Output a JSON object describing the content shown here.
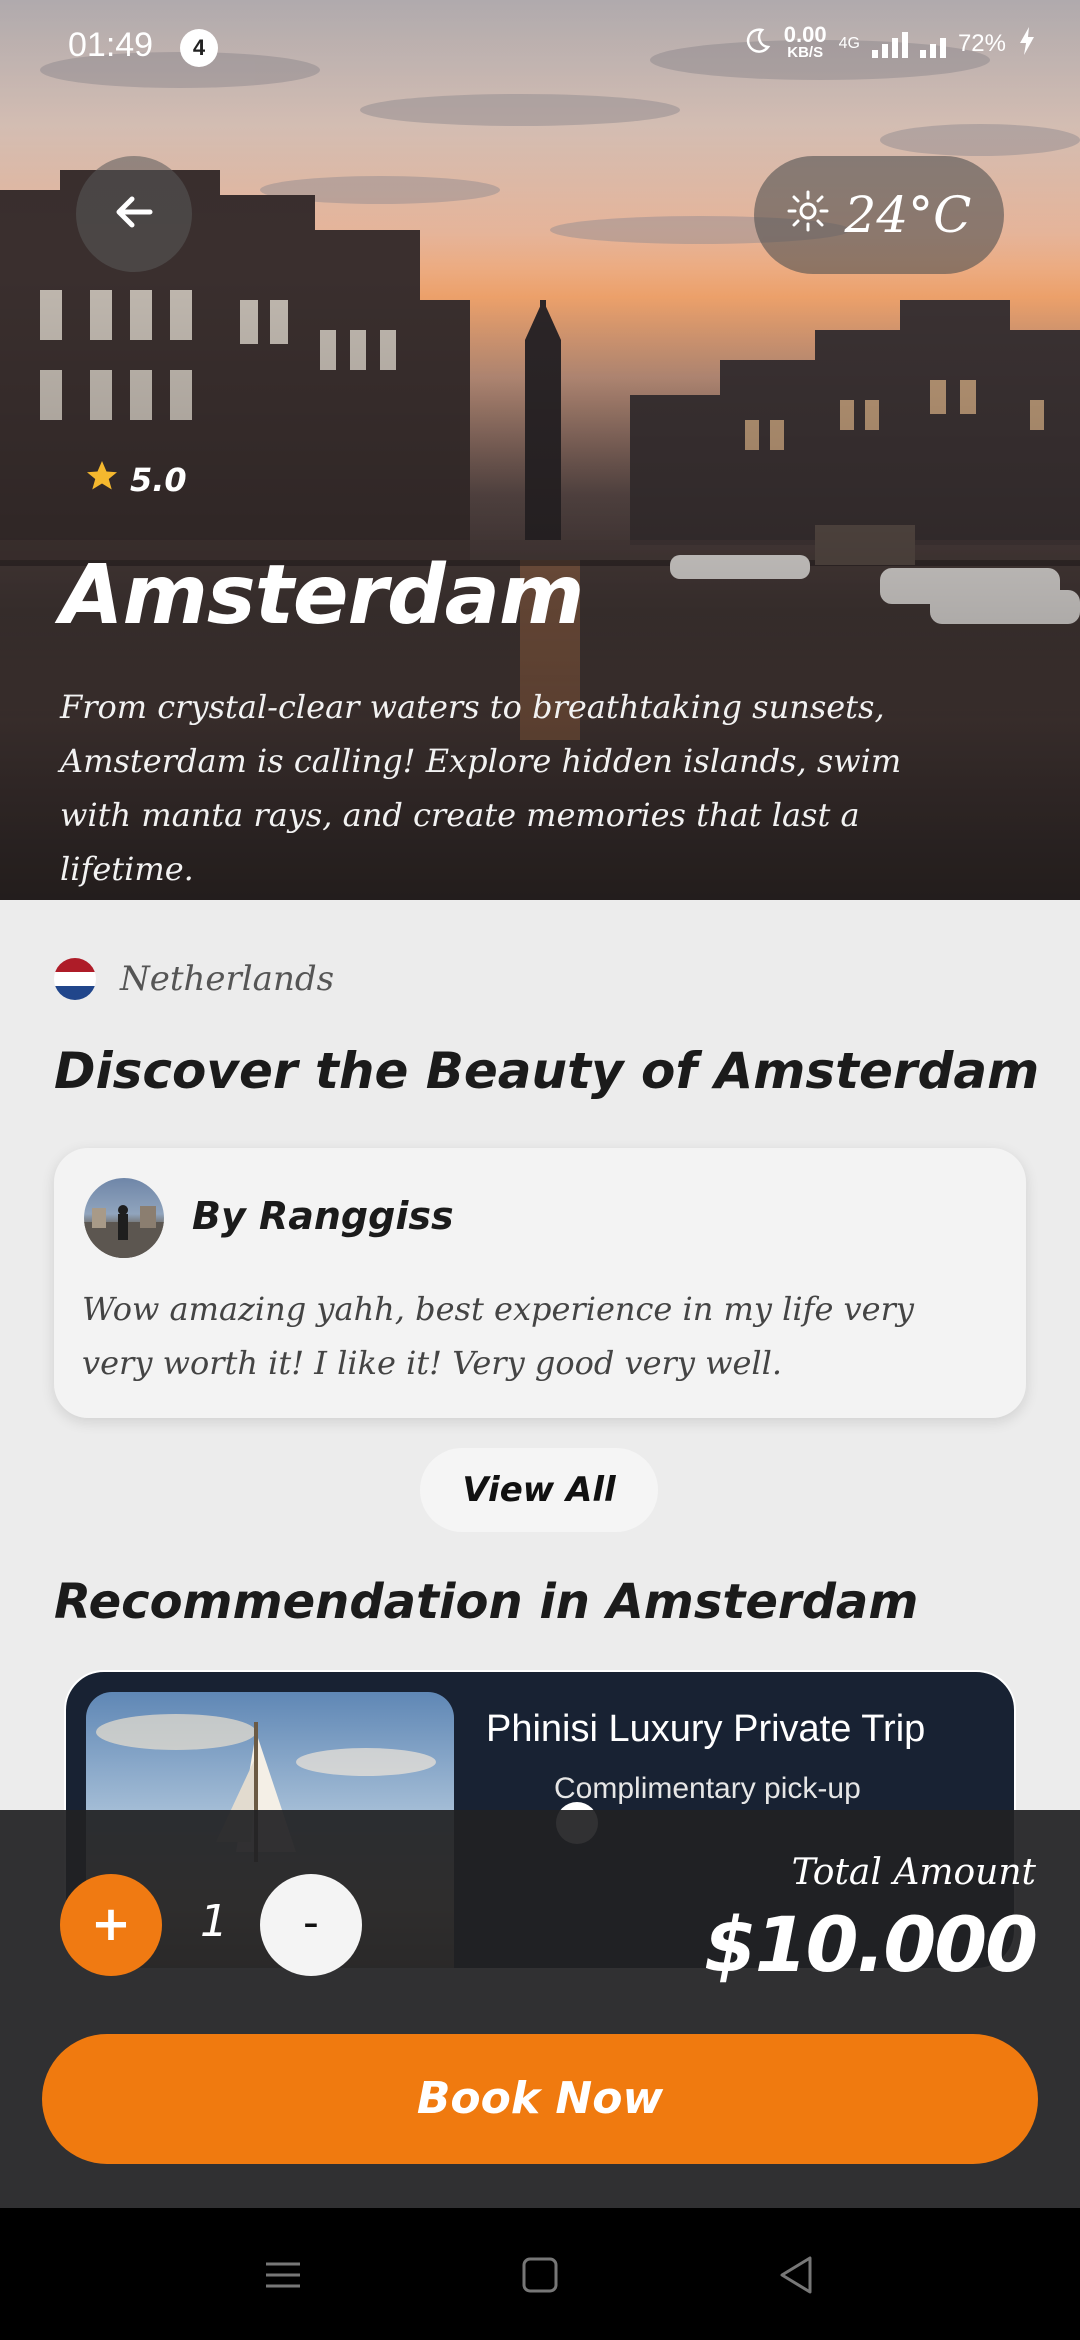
{
  "status_bar": {
    "time": "01:49",
    "notification_count": "4",
    "net_speed_value": "0.00",
    "net_speed_unit": "KB/S",
    "network_type": "4G",
    "battery": "72%"
  },
  "hero": {
    "rating": "5.0",
    "temperature": "24°C",
    "city": "Amsterdam",
    "description": "From crystal-clear waters to breathtaking sunsets, Amsterdam is calling! Explore hidden islands, swim with manta rays, and create memories that last a lifetime."
  },
  "country": {
    "name": "Netherlands",
    "flag_colors": [
      "#ae1c28",
      "#ffffff",
      "#21468b"
    ]
  },
  "discover": {
    "title": "Discover the Beauty of Amsterdam"
  },
  "review": {
    "author": "By Ranggiss",
    "text": "Wow amazing yahh, best experience in my life very very worth it! I like it! Very good very well."
  },
  "view_all_label": "View All",
  "recommendation": {
    "title": "Recommendation in Amsterdam",
    "card_title": "Phinisi Luxury Private Trip",
    "card_feature": "Complimentary pick-up"
  },
  "booking": {
    "plus_label": "+",
    "quantity": "1",
    "minus_label": "-",
    "total_label": "Total Amount",
    "total_amount": "$10.000",
    "book_label": "Book Now"
  },
  "colors": {
    "accent": "#f07a0f",
    "card_dark": "#182233",
    "bar_bg": "#212123"
  },
  "icons": {
    "back": "arrow-left-icon",
    "weather": "sun-icon",
    "rating": "star-icon",
    "nav_menu": "menu-icon",
    "nav_home": "square-icon",
    "nav_back": "triangle-back-icon"
  }
}
